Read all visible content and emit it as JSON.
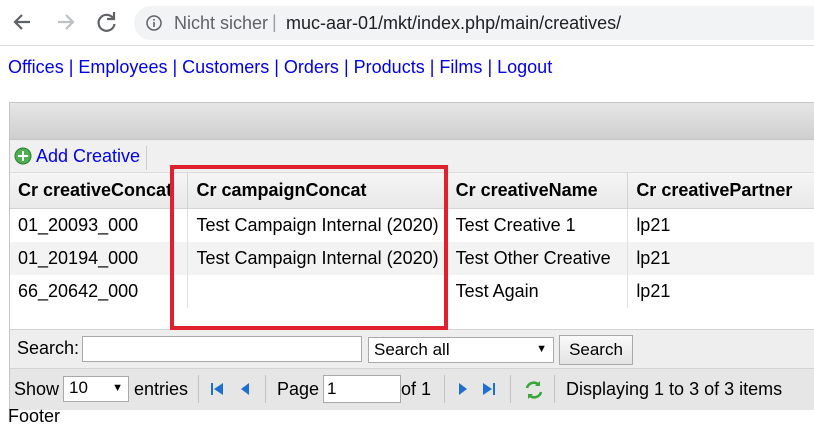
{
  "browser": {
    "security_label": "Nicht sicher",
    "separator": "|",
    "url": "muc-aar-01/mkt/index.php/main/creatives/"
  },
  "nav": {
    "links": [
      "Offices",
      "Employees",
      "Customers",
      "Orders",
      "Products",
      "Films",
      "Logout"
    ],
    "separator": "|"
  },
  "toolbar": {
    "add_label": "Add Creative"
  },
  "table": {
    "columns": [
      "Cr creativeConcat",
      "Cr campaignConcat",
      "Cr creativeName",
      "Cr creativePartner"
    ],
    "rows": [
      [
        "01_20093_000",
        "Test Campaign Internal (2020)",
        "Test Creative 1",
        "lp21"
      ],
      [
        "01_20194_000",
        "Test Campaign Internal (2020)",
        "Test Other Creative",
        "lp21"
      ],
      [
        "66_20642_000",
        "",
        "Test Again",
        "lp21"
      ]
    ]
  },
  "search": {
    "label": "Search:",
    "value": "",
    "field_selected": "Search all",
    "button": "Search"
  },
  "pager": {
    "show_label": "Show",
    "entries_value": "10",
    "entries_label": "entries",
    "page_label": "Page",
    "page_value": "1",
    "of_label": "of 1",
    "status": "Displaying 1 to 3 of 3 items"
  },
  "footer": "Footer",
  "colors": {
    "link": "#0000ee",
    "highlight": "#e0202c"
  }
}
